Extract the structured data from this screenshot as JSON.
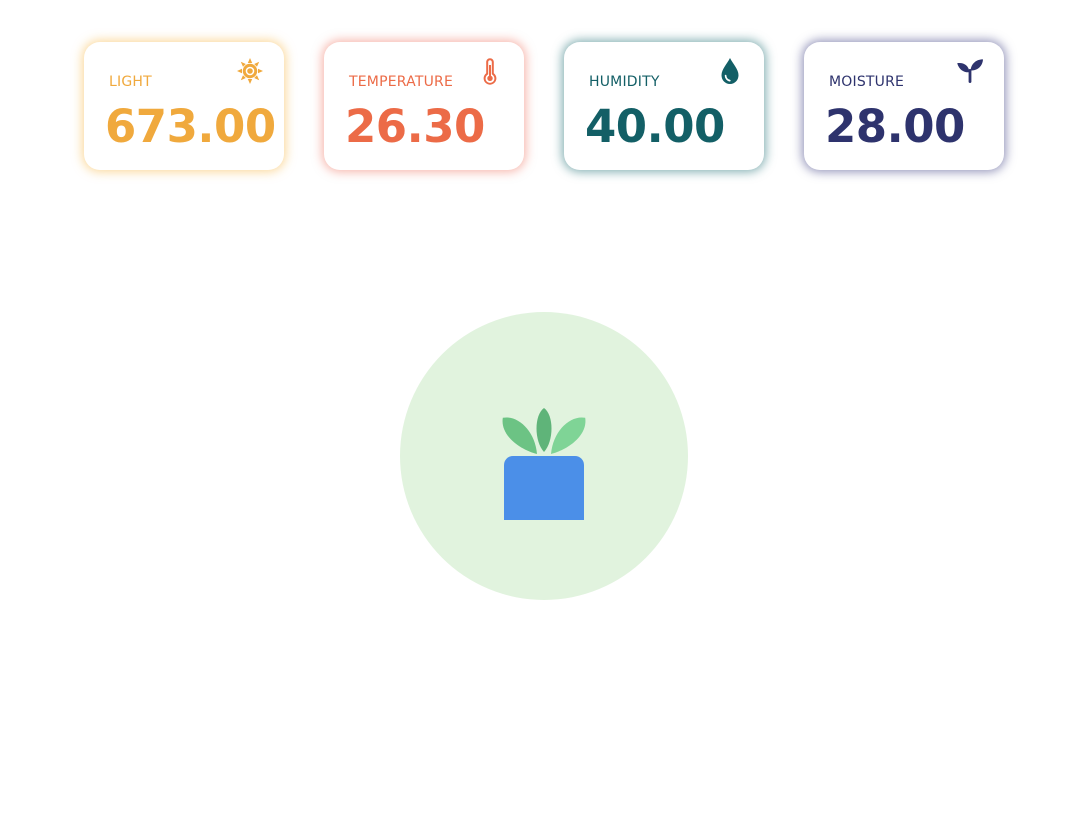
{
  "sensors": [
    {
      "key": "light",
      "label": "LIGHT",
      "value": "673.00",
      "color": "#f0a93d",
      "glow": "rgba(247,186,76,0.55)",
      "icon": "sun-icon"
    },
    {
      "key": "temperature",
      "label": "TEMPERATURE",
      "value": "26.30",
      "color": "#ec6b47",
      "glow": "rgba(240,110,90,0.50)",
      "icon": "thermometer-icon"
    },
    {
      "key": "humidity",
      "label": "HUMIDITY",
      "value": "40.00",
      "color": "#135f66",
      "glow": "rgba(29,110,115,0.55)",
      "icon": "water-drop-icon"
    },
    {
      "key": "moisture",
      "label": "MOISTURE",
      "value": "28.00",
      "color": "#2e336d",
      "glow": "rgba(60,62,130,0.55)",
      "icon": "sprout-icon"
    }
  ],
  "plant": {
    "circle_color": "#e1f3de",
    "pot_color": "#4b8fe8",
    "leaf_colors": [
      "#6cc384",
      "#5fb479",
      "#7fd496"
    ],
    "icon": "potted-plant-icon"
  }
}
